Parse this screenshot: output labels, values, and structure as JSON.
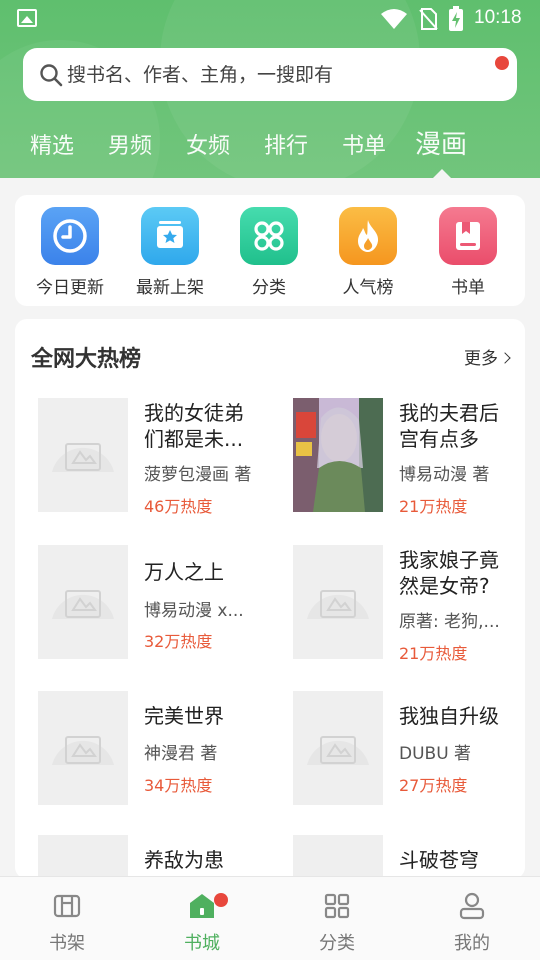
{
  "status_bar": {
    "time": "10:18"
  },
  "search": {
    "placeholder": "搜书名、作者、主角，一搜即有"
  },
  "tabs": [
    "精选",
    "男频",
    "女频",
    "排行",
    "书单",
    "漫画"
  ],
  "active_tab": "漫画",
  "quick_links": [
    {
      "label": "今日更新",
      "icon": "clock-icon",
      "color": "#3d8ef0"
    },
    {
      "label": "最新上架",
      "icon": "star-box-icon",
      "color": "#35b6f0"
    },
    {
      "label": "分类",
      "icon": "grid-flower-icon",
      "color": "#2ed09c"
    },
    {
      "label": "人气榜",
      "icon": "flame-icon",
      "color": "#f6a52b"
    },
    {
      "label": "书单",
      "icon": "bookmark-book-icon",
      "color": "#ef5b78"
    }
  ],
  "hot_section": {
    "title": "全网大热榜",
    "more": "更多",
    "books": [
      {
        "title": "我的女徒弟们都是未...",
        "author": "菠萝包漫画 著",
        "heat": "46万热度"
      },
      {
        "title": "我的夫君后宫有点多",
        "author": "博易动漫 著",
        "heat": "21万热度"
      },
      {
        "title": "万人之上",
        "author": "博易动漫 x...",
        "heat": "32万热度"
      },
      {
        "title": "我家娘子竟然是女帝?",
        "author": "原著: 老狗,...",
        "heat": "21万热度"
      },
      {
        "title": "完美世界",
        "author": "神漫君 著",
        "heat": "34万热度"
      },
      {
        "title": "我独自升级",
        "author": "DUBU 著",
        "heat": "27万热度"
      },
      {
        "title": "养敌为患",
        "author": "",
        "heat": ""
      },
      {
        "title": "斗破苍穹",
        "author": "",
        "heat": ""
      }
    ]
  },
  "bottom_nav": [
    {
      "label": "书架",
      "icon": "bookshelf-icon"
    },
    {
      "label": "书城",
      "icon": "home-icon"
    },
    {
      "label": "分类",
      "icon": "category-grid-icon"
    },
    {
      "label": "我的",
      "icon": "person-icon"
    }
  ],
  "colors": {
    "brand_green": "#5fbf6e",
    "heat_red": "#e85a3a",
    "badge_red": "#e8473c"
  }
}
